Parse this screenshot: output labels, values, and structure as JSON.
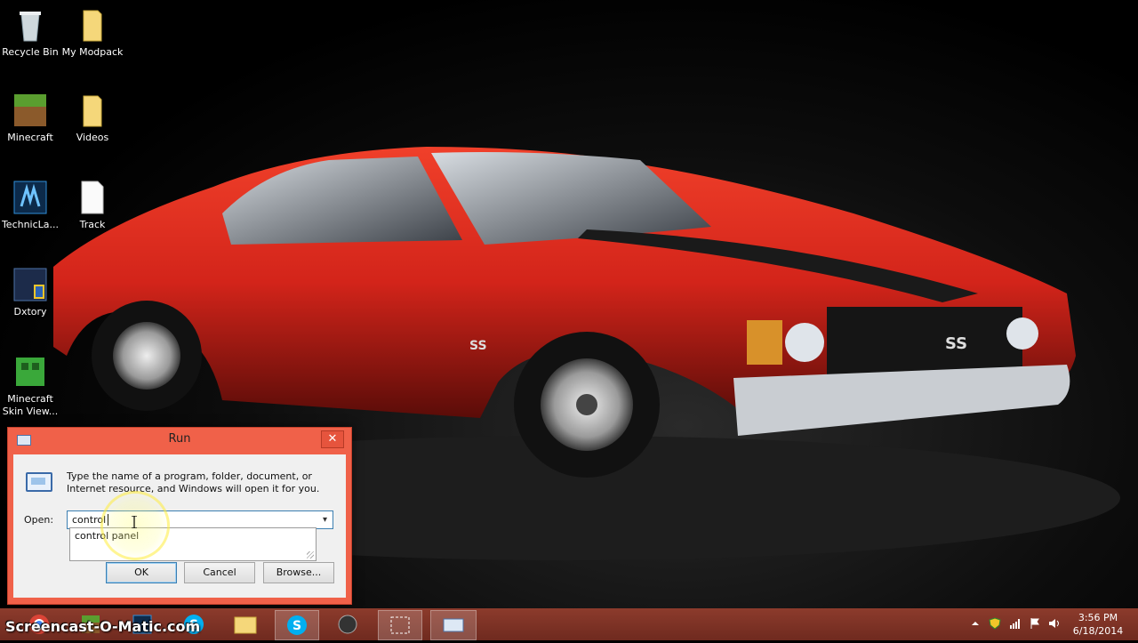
{
  "desktop": {
    "icons": [
      {
        "label": "Recycle Bin",
        "icon": "recycle-bin-icon"
      },
      {
        "label": "My Modpack",
        "icon": "folder-icon"
      },
      {
        "label": "Minecraft",
        "icon": "minecraft-grass-block-icon"
      },
      {
        "label": "Videos",
        "icon": "folder-icon"
      },
      {
        "label": "TechnicLa...",
        "icon": "technic-launcher-icon"
      },
      {
        "label": "Track",
        "icon": "file-icon"
      },
      {
        "label": "Dxtory",
        "icon": "dxtory-icon"
      },
      {
        "label": "Minecraft Skin View...",
        "icon": "minecraft-skin-viewer-icon"
      }
    ],
    "wallpaper_text": {
      "side_badge": "SS",
      "grille_badge": "SS"
    }
  },
  "run_dialog": {
    "title": "Run",
    "close_glyph": "✕",
    "description": "Type the name of a program, folder, document, or Internet resource, and Windows will open it for you.",
    "open_label": "Open:",
    "open_value": "control",
    "autocomplete_suggestion": "control panel",
    "ok_label": "OK",
    "cancel_label": "Cancel",
    "browse_label": "Browse..."
  },
  "taskbar": {
    "watermark": "Screencast-O-Matic.com",
    "pinned": [
      "chrome-icon",
      "minecraft-icon",
      "technic-icon",
      "skype-icon",
      "file-explorer-icon",
      "skype-icon",
      "sony-vegas-icon",
      "snipping-tool-icon",
      "run-icon"
    ],
    "clock": {
      "time": "3:56 PM",
      "date": "6/18/2014"
    },
    "tray": [
      "show-hidden-icons-arrow",
      "shield-icon",
      "network-signal-icon",
      "flag-icon",
      "volume-icon"
    ]
  },
  "colors": {
    "title_bar": "#f06149",
    "taskbar": "#7a3124",
    "car_body": "#d9281b"
  }
}
